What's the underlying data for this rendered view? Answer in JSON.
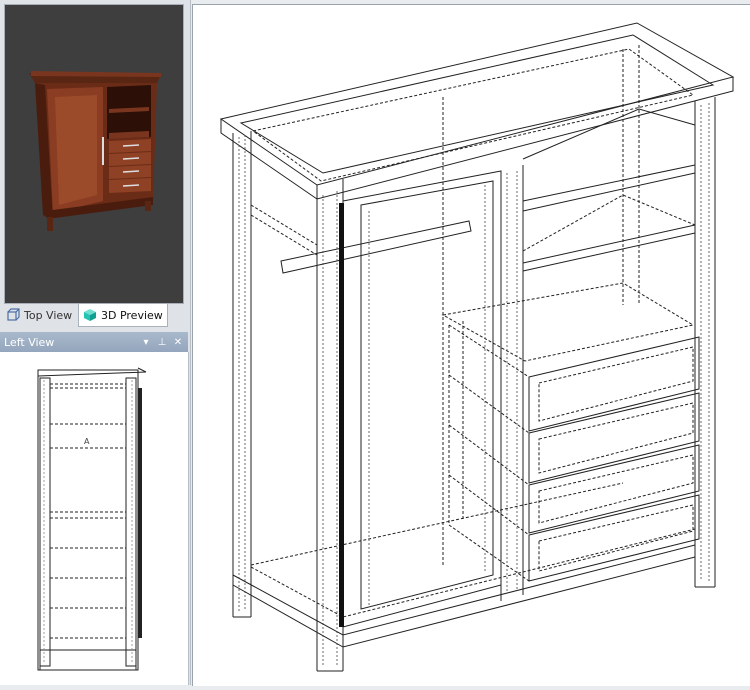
{
  "tabs": [
    {
      "label": "Top View",
      "icon": "cube-outline-icon",
      "active": false
    },
    {
      "label": "3D Preview",
      "icon": "cube-color-icon",
      "active": true
    }
  ],
  "left_view_panel": {
    "title": "Left View",
    "controls": [
      "dropdown-arrow-icon",
      "pin-icon",
      "close-icon"
    ],
    "marker_label": "A"
  },
  "colors": {
    "preview_bg": "#3e3e3e",
    "wood": "#8a3d22",
    "panel_header": "#9aabc2",
    "tab_active_icon": "#24c3b3"
  }
}
